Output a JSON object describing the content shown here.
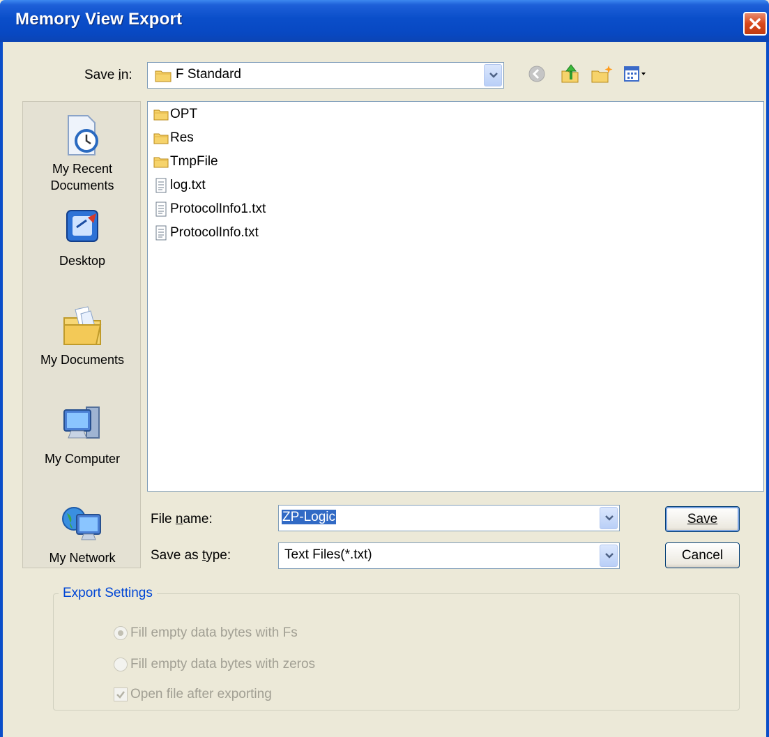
{
  "window": {
    "title": "Memory View Export",
    "close_label": "close"
  },
  "save_in": {
    "label": "Save in:",
    "value": "F Standard"
  },
  "toolbar": {
    "icons": [
      "back-icon",
      "up-folder-icon",
      "new-folder-icon",
      "view-menu-icon"
    ]
  },
  "places": {
    "items": [
      {
        "label_line1": "My Recent",
        "label_line2": "Documents",
        "icon": "recent-documents-icon"
      },
      {
        "label": "Desktop",
        "icon": "desktop-icon"
      },
      {
        "label": "My Documents",
        "icon": "my-documents-icon"
      },
      {
        "label": "My Computer",
        "icon": "my-computer-icon"
      },
      {
        "label": "My Network",
        "icon": "my-network-icon"
      }
    ]
  },
  "files": [
    {
      "name": "OPT",
      "type": "folder"
    },
    {
      "name": "Res",
      "type": "folder"
    },
    {
      "name": "TmpFile",
      "type": "folder"
    },
    {
      "name": "log.txt",
      "type": "text"
    },
    {
      "name": "ProtocolInfo1.txt",
      "type": "text"
    },
    {
      "name": "ProtocolInfo.txt",
      "type": "text"
    }
  ],
  "file_name": {
    "label": "File name:",
    "value": "ZP-Logic"
  },
  "save_as_type": {
    "label": "Save as type:",
    "value": "Text Files(*.txt)"
  },
  "buttons": {
    "save": "Save",
    "cancel": "Cancel"
  },
  "export_settings": {
    "title": "Export Settings",
    "option_fill_fs": "Fill empty data bytes with Fs",
    "option_fill_zeros": "Fill empty data bytes with zeros",
    "option_open_after": "Open file after exporting",
    "fill_fs_selected": true,
    "open_after_checked": true,
    "enabled": false
  },
  "colors": {
    "titlebar": "#0a4ec9",
    "dialog_bg": "#ece9d8",
    "selection": "#316ac5",
    "group_title": "#0046d5"
  }
}
